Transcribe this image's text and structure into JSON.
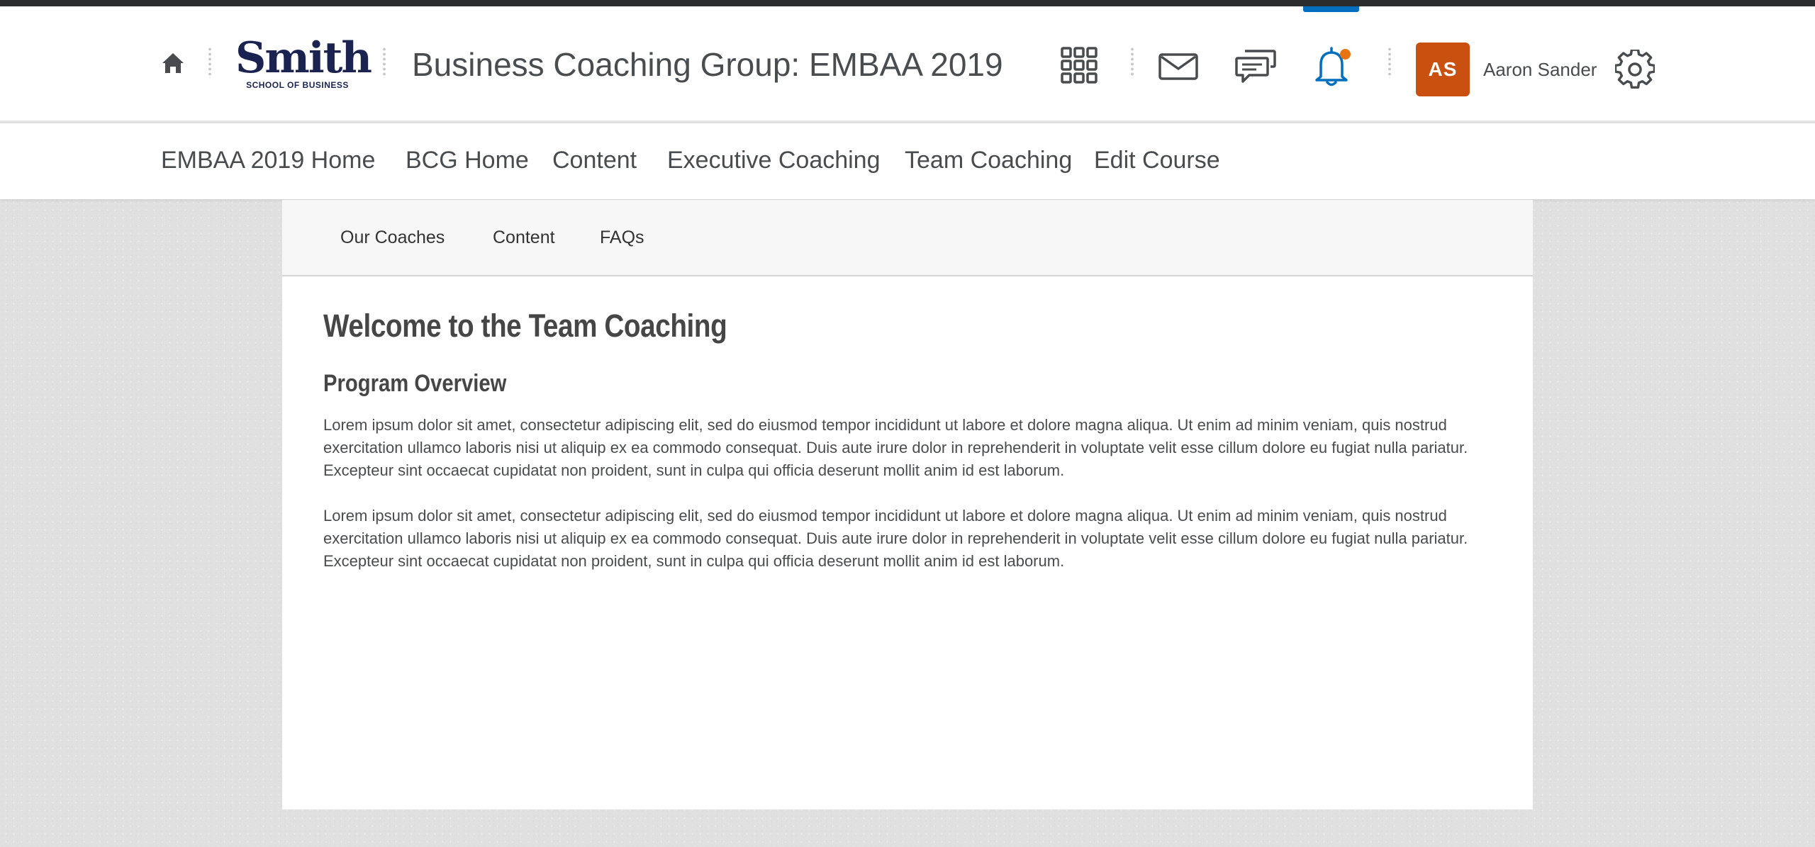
{
  "header": {
    "course_title": "Business Coaching Group: EMBAA 2019",
    "logo": {
      "name": "Smith",
      "subtitle": "SCHOOL OF BUSINESS"
    },
    "user": {
      "initials": "AS",
      "name": "Aaron Sander"
    },
    "icons": [
      "home-icon",
      "app-grid-icon",
      "mail-icon",
      "chat-icon",
      "bell-icon",
      "gear-icon"
    ],
    "colors": {
      "avatar": "#c9500e",
      "notification_dot": "#e87511",
      "bell": "#006fbf",
      "logo": "#1b2350"
    }
  },
  "navbar": {
    "items": [
      "EMBAA 2019 Home",
      "BCG Home",
      "Content",
      "Executive Coaching",
      "Team Coaching",
      "Edit Course"
    ]
  },
  "subnav": {
    "items": [
      "Our Coaches",
      "Content",
      "FAQs"
    ]
  },
  "main": {
    "title": "Welcome to the Team Coaching",
    "subtitle": "Program Overview",
    "paragraphs": [
      "Lorem ipsum dolor sit amet, consectetur adipiscing elit, sed do eiusmod tempor incididunt ut labore et dolore magna aliqua. Ut enim ad minim veniam, quis nostrud exercitation ullamco laboris nisi ut aliquip ex ea commodo consequat. Duis aute irure dolor in reprehenderit in voluptate velit esse cillum dolore eu fugiat nulla pariatur. Excepteur sint occaecat cupidatat non proident, sunt in culpa qui officia deserunt mollit anim id est laborum.",
      "Lorem ipsum dolor sit amet, consectetur adipiscing elit, sed do eiusmod tempor incididunt ut labore et dolore magna aliqua. Ut enim ad minim veniam, quis nostrud exercitation ullamco laboris nisi ut aliquip ex ea commodo consequat. Duis aute irure dolor in reprehenderit in voluptate velit esse cillum dolore eu fugiat nulla pariatur. Excepteur sint occaecat cupidatat non proident, sunt in culpa qui officia deserunt mollit anim id est laborum."
    ]
  }
}
